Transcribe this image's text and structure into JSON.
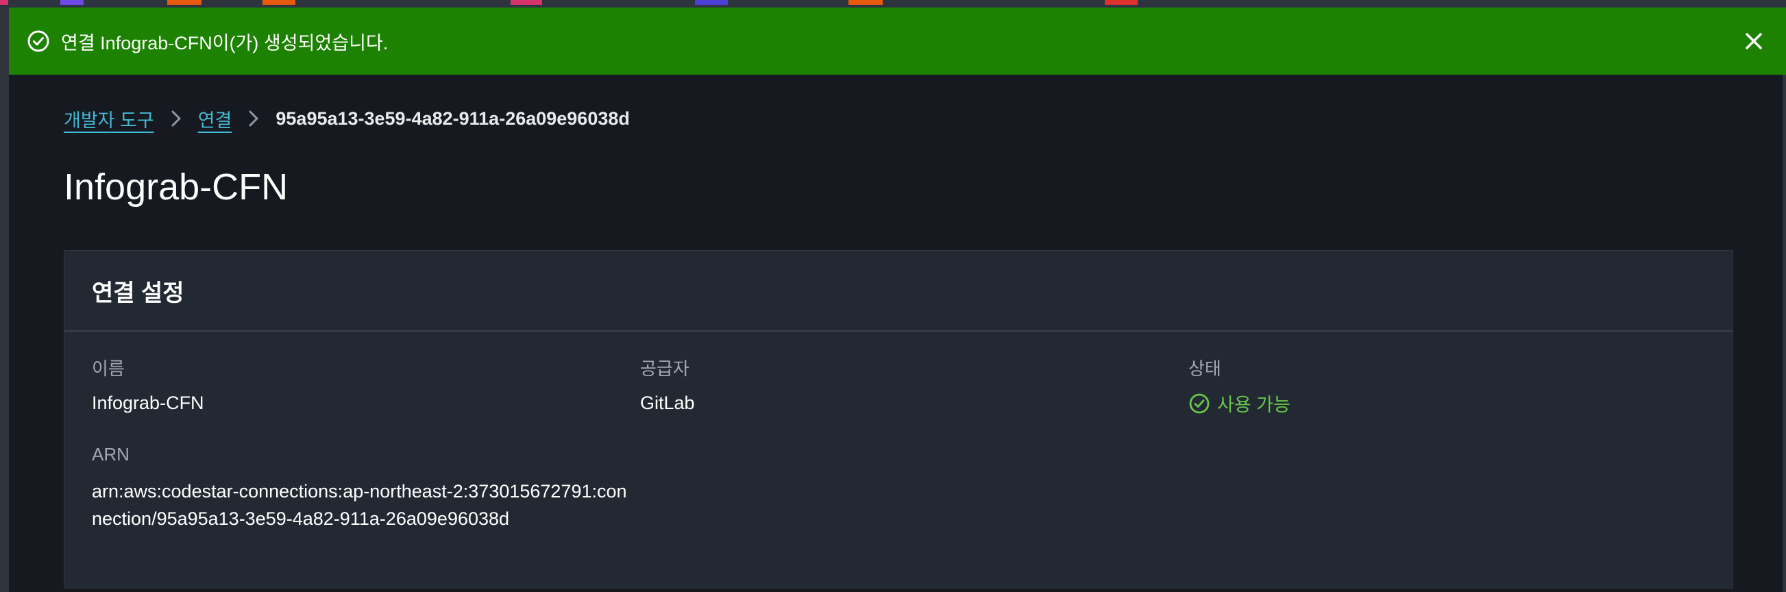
{
  "colors": {
    "flash_bg": "#1d8102",
    "link": "#44b9d6",
    "status_ok": "#67c84b",
    "page_bg": "#16191f",
    "panel_bg": "#232933"
  },
  "flash": {
    "icon": "check-circle-icon",
    "message": "연결 Infograb-CFN이(가) 생성되었습니다.",
    "close_icon": "close-icon"
  },
  "breadcrumb": {
    "items": [
      {
        "label": "개발자 도구"
      },
      {
        "label": "연결"
      }
    ],
    "current": "95a95a13-3e59-4a82-911a-26a09e96038d"
  },
  "page": {
    "title": "Infograb-CFN"
  },
  "panel": {
    "title": "연결 설정",
    "fields": {
      "name": {
        "label": "이름",
        "value": "Infograb-CFN"
      },
      "provider": {
        "label": "공급자",
        "value": "GitLab"
      },
      "status": {
        "label": "상태",
        "value": "사용 가능",
        "icon": "check-circle-icon"
      },
      "arn": {
        "label": "ARN",
        "value": "arn:aws:codestar-connections:ap-northeast-2:373015672791:connection/95a95a13-3e59-4a82-911a-26a09e96038d"
      }
    }
  }
}
